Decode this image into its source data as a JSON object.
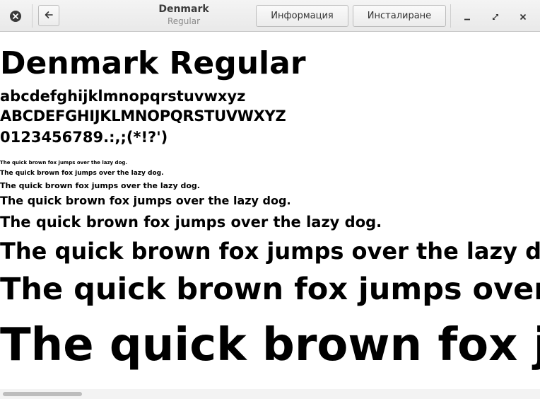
{
  "window": {
    "title": "Denmark",
    "subtitle": "Regular",
    "info_button": "Информация",
    "install_button": "Инсталиране"
  },
  "preview": {
    "heading": "Denmark Regular",
    "lowercase": "abcdefghijklmnopqrstuvwxyz",
    "uppercase": "ABCDEFGHIJKLMNOPQRSTUVWXYZ",
    "digits": "0123456789.:,;(*!?')",
    "pangram": "The quick brown fox jumps over the lazy dog."
  },
  "scrollbar": {
    "position_fraction": 0.0
  }
}
